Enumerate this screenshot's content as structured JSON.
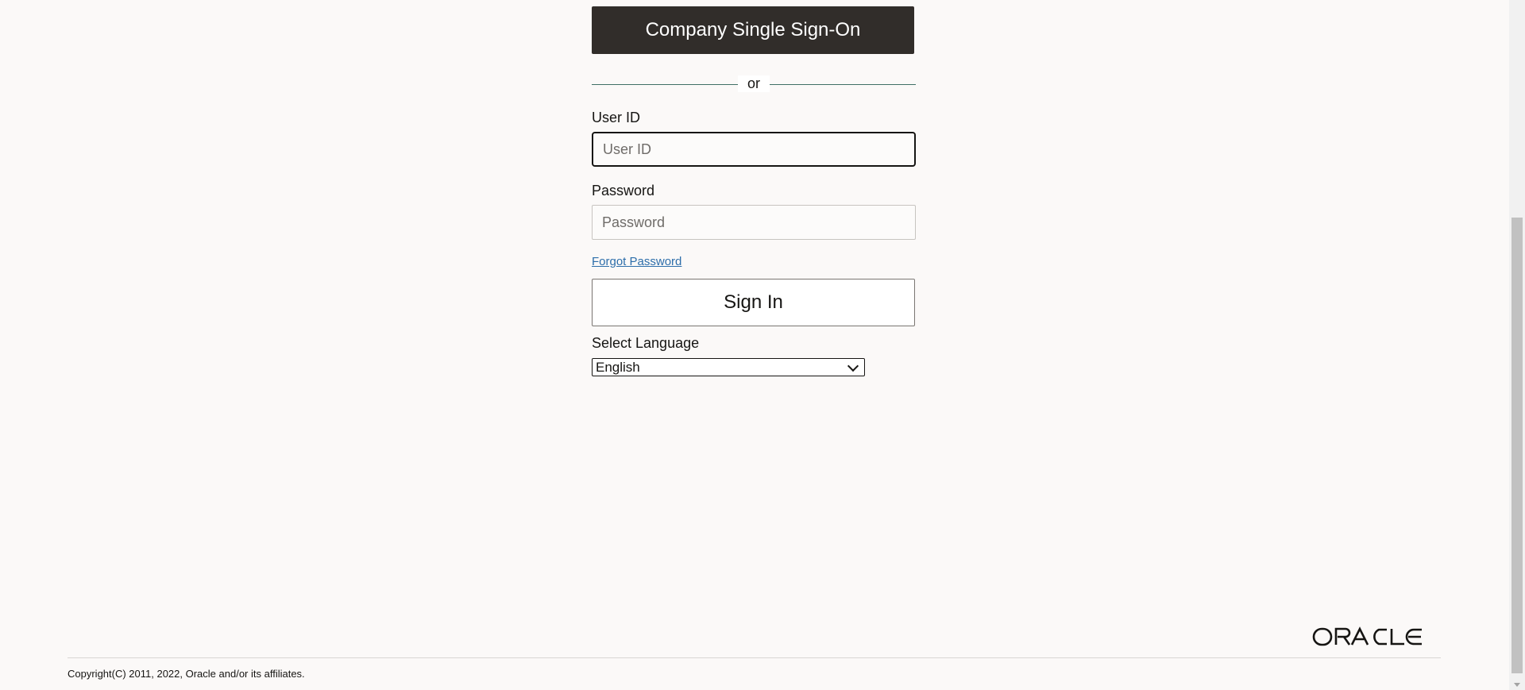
{
  "sso": {
    "label": "Company Single Sign-On"
  },
  "divider": {
    "text": "or"
  },
  "user_id": {
    "label": "User ID",
    "placeholder": "User ID",
    "value": ""
  },
  "password": {
    "label": "Password",
    "placeholder": "Password",
    "value": ""
  },
  "forgot_password": {
    "label": "Forgot Password"
  },
  "sign_in": {
    "label": "Sign In"
  },
  "language": {
    "label": "Select Language",
    "selected": "English"
  },
  "footer": {
    "logo_text": "ORACLE",
    "copyright": "Copyright(C) 2011, 2022, Oracle and/or its affiliates."
  },
  "colors": {
    "page_bg": "#fbf9f8",
    "sso_bg": "#312d2a",
    "link": "#2d6eaa",
    "divider": "#3f6f66"
  }
}
